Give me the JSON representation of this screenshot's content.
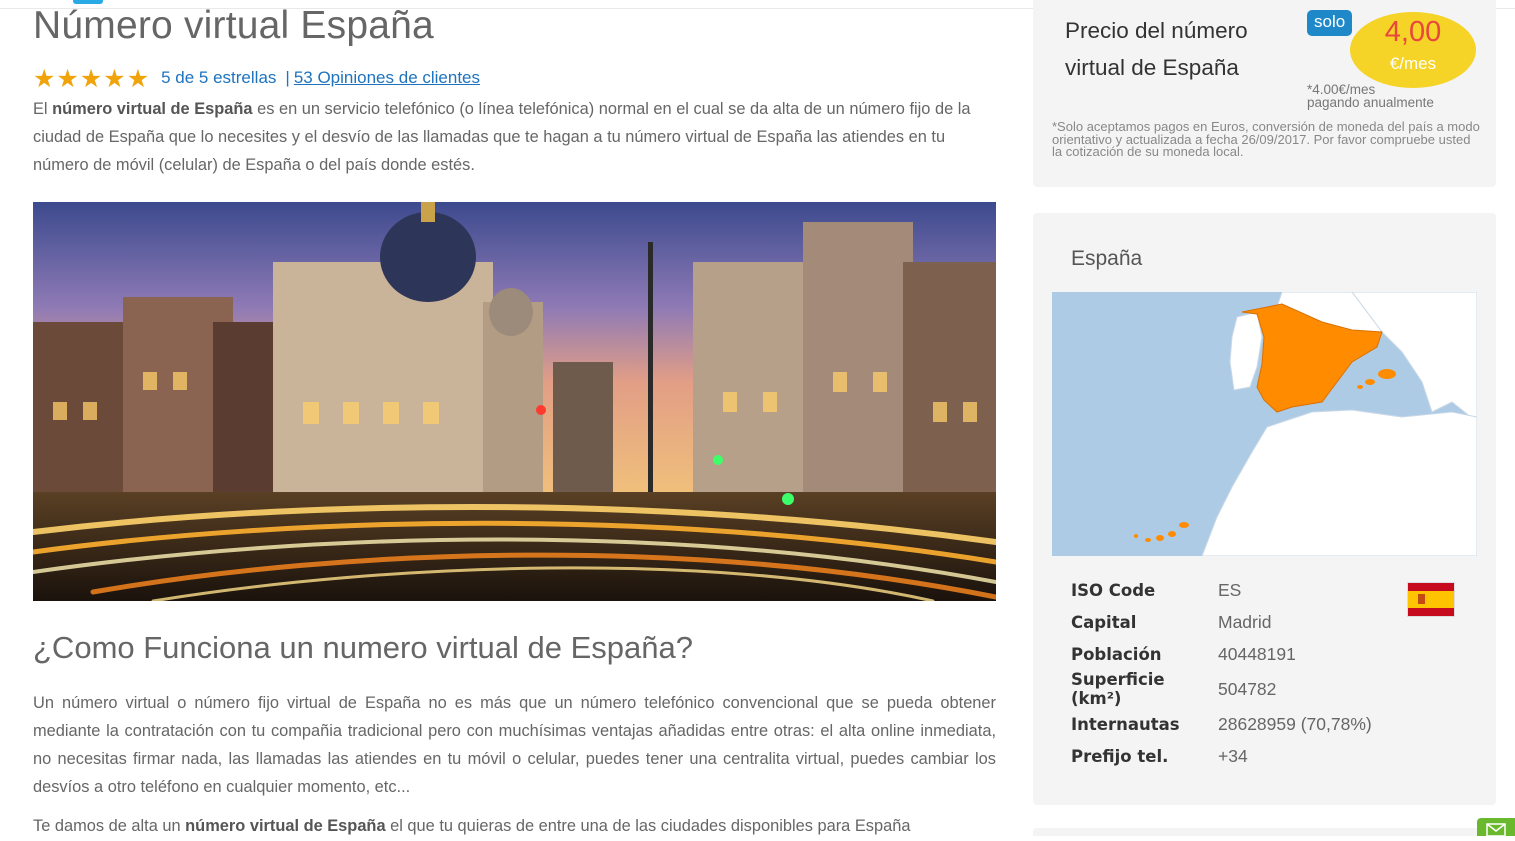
{
  "main": {
    "title": "Número virtual España",
    "rating": {
      "stars": 5,
      "stars_text": "5 de 5 estrellas",
      "separator": "|",
      "reviews_text": "53 Opiniones de clientes"
    },
    "intro": {
      "p1": "El ",
      "b1": "número virtual de España",
      "p2": " es en un servicio telefónico (o línea telefónica) normal en el cual se da alta de un número fijo de la ciudad de España que lo necesites y  el desvío de las llamadas que te hagan a tu número virtual de España las atiendes en tu número de móvil (celular) de España o del país donde estés."
    },
    "section_title": "¿Como Funciona un numero virtual de España?",
    "section_body": "Un número virtual o número fijo virtual de España no es más que un número telefónico convencional que se pueda obtener mediante la contratación con tu compañia tradicional pero con muchísimas ventajas añadidas entre otras: el alta online inmediata, no necesitas firmar nada, las llamadas las atiendes en tu móvil o celular, puedes tener una centralita virtual, puedes cambiar los desvíos a otro teléfono en cualquier momento, etc...",
    "section_body2": {
      "p1": "Te damos de alta un ",
      "b1": "número virtual de España",
      "p2": " el que tu quieras de entre una de las ciudades disponibles para España"
    }
  },
  "price_box": {
    "label": "Precio del número virtual de España",
    "badge": "solo",
    "amount": "4,00",
    "unit": "€/mes",
    "note_line1": "*4.00€/mes",
    "note_line2": "pagando anualmente",
    "disclaimer": "*Solo aceptamos pagos en Euros, conversión de moneda del país a modo orientativo y actualizada a fecha 26/09/2017. Por favor compruebe usted la cotización de su moneda local."
  },
  "country": {
    "name": "España",
    "info": [
      {
        "key": "ISO Code",
        "value": "ES"
      },
      {
        "key": "Capital",
        "value": "Madrid"
      },
      {
        "key": "Población",
        "value": "40448191"
      },
      {
        "key": "Superficie (km²)",
        "value": "504782"
      },
      {
        "key": "Internautas",
        "value": "28628959 (70,78%)"
      },
      {
        "key": "Prefijo tel.",
        "value": "+34"
      }
    ]
  },
  "colors": {
    "link": "#1e73be",
    "star": "#f0a30a",
    "badge": "#1e88c8",
    "price_circle": "#f5d327",
    "price_amount": "#e8473e",
    "map_highlight": "#ff8c00",
    "map_sea": "#aecbe6",
    "mail_tab": "#6ab82e"
  },
  "icons": {
    "rating": "star-icon",
    "flag": "spain-flag-icon",
    "mail": "mail-icon"
  }
}
